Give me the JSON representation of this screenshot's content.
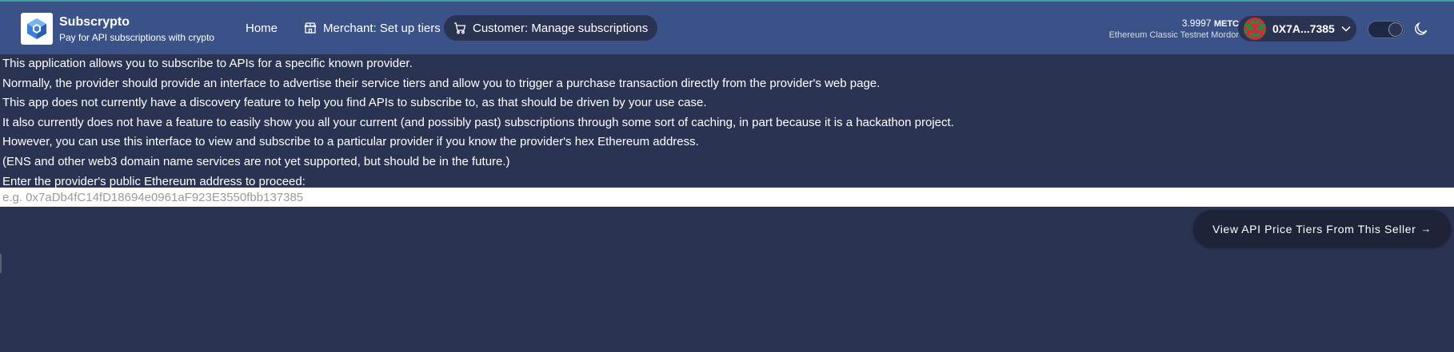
{
  "app": {
    "title": "Subscrypto",
    "subtitle": "Pay for API subscriptions with crypto"
  },
  "nav": {
    "home": "Home",
    "merchant": "Merchant: Set up tiers",
    "customer": "Customer: Manage subscriptions"
  },
  "wallet": {
    "balance": "3.9997",
    "unit": "METC",
    "network": "Ethereum Classic Testnet Mordor",
    "address": "0X7A...7385"
  },
  "theme": {
    "mode": "dark"
  },
  "intro": {
    "lines": [
      "This application allows you to subscribe to APIs for a specific known provider.",
      "Normally, the provider should provide an interface to advertise their service tiers and allow you to trigger a purchase transaction directly from the provider's web page.",
      "This app does not currently have a discovery feature to help you find APIs to subscribe to, as that should be driven by your use case.",
      "It also currently does not have a feature to easily show you all your current (and possibly past) subscriptions through some sort of caching, in part because it is a hackathon project.",
      "However, you can use this interface to view and subscribe to a particular provider if you know the provider's hex Ethereum address.",
      "(ENS and other web3 domain name services are not yet supported, but should be in the future.)",
      "Enter the provider's public Ethereum address to proceed:"
    ]
  },
  "address_input": {
    "placeholder": "e.g. 0x7aDb4fC14fD18694e0961aF923E3550fbb137385",
    "value": ""
  },
  "cta": {
    "label": "View API Price Tiers From This Seller",
    "arrow": "→"
  },
  "colors": {
    "navbar": "#3a5287",
    "background": "#2a3352",
    "pill": "#2a3352",
    "button": "#1e2338"
  }
}
